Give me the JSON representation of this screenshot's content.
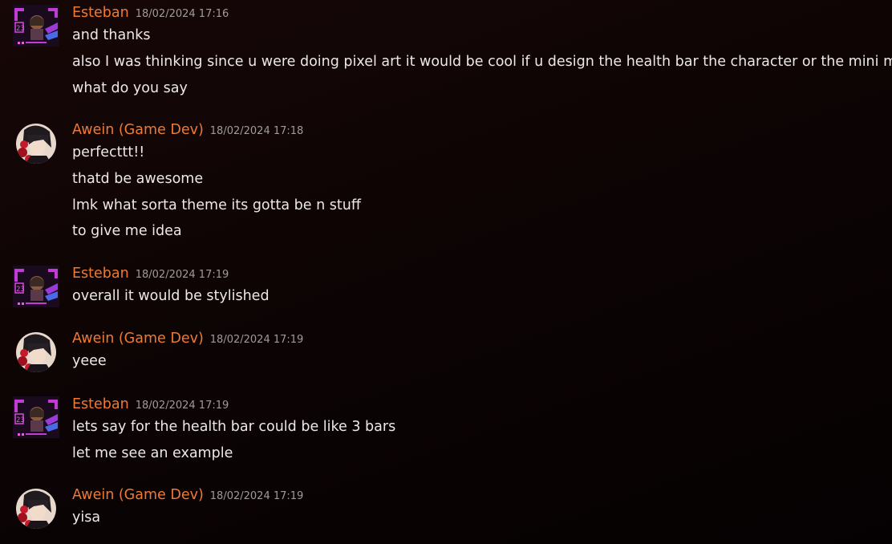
{
  "messages": [
    {
      "author": "Esteban",
      "avatar": "pixel-cyber-avatar",
      "timestamp": "18/02/2024 17:16",
      "lines": [
        "and thanks",
        "also I was thinking since u were doing pixel art it would be cool if u design the health bar the character or the mini map",
        "what do you say"
      ]
    },
    {
      "author": "Awein (Game Dev)",
      "avatar": "anime-character-avatar",
      "timestamp": "18/02/2024 17:18",
      "lines": [
        "perfecttt!!",
        "thatd be awesome",
        "lmk what sorta theme its gotta be n stuff",
        "to give me idea"
      ]
    },
    {
      "author": "Esteban",
      "avatar": "pixel-cyber-avatar",
      "timestamp": "18/02/2024 17:19",
      "lines": [
        "overall it would be stylished"
      ]
    },
    {
      "author": "Awein (Game Dev)",
      "avatar": "anime-character-avatar",
      "timestamp": "18/02/2024 17:19",
      "lines": [
        "yeee"
      ]
    },
    {
      "author": "Esteban",
      "avatar": "pixel-cyber-avatar",
      "timestamp": "18/02/2024 17:19",
      "lines": [
        "lets say for the health bar could be like 3 bars",
        "let me see an example"
      ]
    },
    {
      "author": "Awein (Game Dev)",
      "avatar": "anime-character-avatar",
      "timestamp": "18/02/2024 17:19",
      "lines": [
        "yisa"
      ]
    }
  ],
  "colors": {
    "username": "#ee7a34",
    "timestamp": "#a09b9b",
    "text": "#ece8e8",
    "background": "#0d0404"
  }
}
